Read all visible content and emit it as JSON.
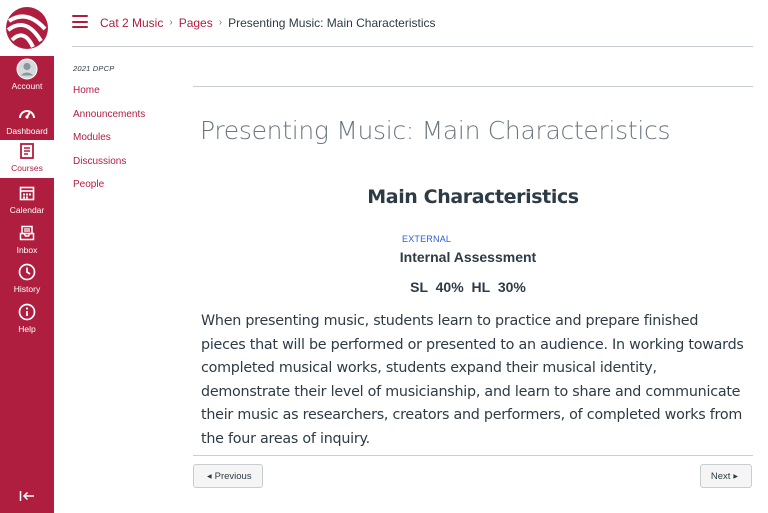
{
  "global_nav": {
    "items": [
      {
        "label": "Account",
        "icon": "avatar-icon"
      },
      {
        "label": "Dashboard",
        "icon": "dashboard-icon"
      },
      {
        "label": "Courses",
        "icon": "courses-icon"
      },
      {
        "label": "Calendar",
        "icon": "calendar-icon"
      },
      {
        "label": "Inbox",
        "icon": "inbox-icon"
      },
      {
        "label": "History",
        "icon": "clock-icon"
      },
      {
        "label": "Help",
        "icon": "help-icon"
      }
    ],
    "collapse_icon": "collapse-icon",
    "brand_color": "#b01e3f"
  },
  "breadcrumb": {
    "course": "Cat 2 Music",
    "section": "Pages",
    "current": "Presenting Music: Main Characteristics",
    "separator": "›"
  },
  "course_nav": {
    "title": "2021 DPCP",
    "items": [
      "Home",
      "Announcements",
      "Modules",
      "Discussions",
      "People"
    ]
  },
  "page": {
    "title": "Presenting Music: Main Characteristics",
    "heading": "Main Characteristics",
    "tag": "EXTERNAL",
    "assessment": "Internal Assessment",
    "sl": "SL 40%",
    "hl": "HL 30%",
    "body": "When presenting music, students learn to practice and prepare finished pieces that will be performed or presented to an audience. In working towards completed musical works, students expand their musical identity, demonstrate their level of musicianship, and learn to share and communicate their music as researchers, creators and performers, of completed works from the four areas of inquiry."
  },
  "pager": {
    "previous": "Previous",
    "next": "Next"
  }
}
